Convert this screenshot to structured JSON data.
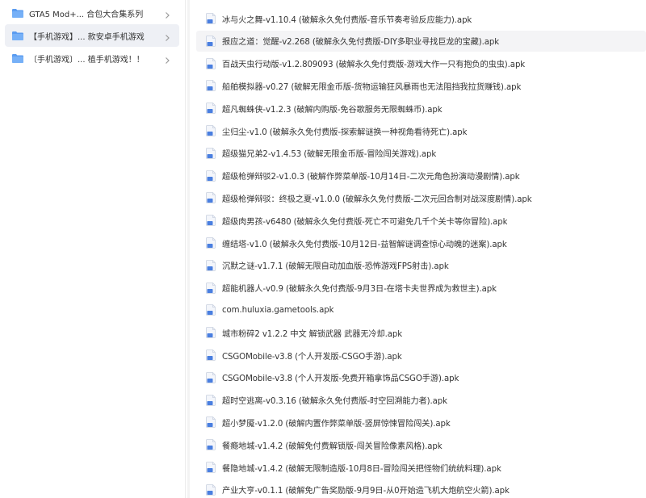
{
  "sidebar": {
    "items": [
      {
        "label": "GTA5 Mod+... 合包大合集系列",
        "icon": "folder-icon",
        "selected": false
      },
      {
        "label": "【手机游戏】... 款安卓手机游戏",
        "icon": "folder-icon",
        "selected": true
      },
      {
        "label": "〔手机游戏〕... 植手机游戏！！",
        "icon": "folder-icon",
        "selected": false
      }
    ]
  },
  "colors": {
    "folder": "#5b9cf0",
    "selected_bg": "#eef0f5",
    "apk_icon": "#4a7fe0"
  },
  "files": [
    "冰与火之舞-v1.10.4 (破解永久免付费版-音乐节奏考验反应能力).apk",
    "报应之道：觉醒-v2.268 (破解永久免付费版-DIY多职业寻找巨龙的宝藏).apk",
    "百战天虫行动版-v1.2.809093 (破解永久免付费版-游戏大作一只有抱负的虫虫).apk",
    "船舶模拟器-v0.27 (破解无限金币版-货物运输狂风暴雨也无法阻挡我拉货赚钱).apk",
    "超凡蜘蛛侠-v1.2.3 (破解内购版-免谷歌服务无限蜘蛛币).apk",
    "尘归尘-v1.0 (破解永久免付费版-探索解谜换一种视角看待死亡).apk",
    "超级猫兄弟2-v1.4.53 (破解无限金币版-冒险闯关游戏).apk",
    "超级枪弹辩驳2-v1.0.3 (破解作弊菜单版-10月14日-二次元角色扮演动漫剧情).apk",
    "超级枪弹辩驳：终极之夏-v1.0.0 (破解永久免付费版-二次元回合制对战深度剧情).apk",
    "超级肉男孩-v6480 (破解永久免付费版-死亡不可避免几千个关卡等你冒险).apk",
    "缠结塔-v1.0 (破解永久免付费版-10月12日-益智解谜调查惊心动魄的迷案).apk",
    "沉默之谜-v1.7.1 (破解无限自动加血版-恐怖游戏FPS射击).apk",
    "超能机器人-v0.9 (破解永久免付费版-9月3日-在塔卡夫世界成为救世主).apk",
    "com.huluxia.gametools.apk",
    "城市粉碎2 v1.2.2 中文 解锁武器 武器无冷却.apk",
    "CSGOMobile-v3.8 (个人开发版-CSGO手游).apk",
    "CSGOMobile-v3.8 (个人开发版-免费开箱拿饰品CSGO手游).apk",
    "超时空逃离-v0.3.16 (破解永久免付费版-时空回溯能力者).apk",
    "超小梦魇-v1.2.0 (破解内置作弊菜单版-竖屏惊悚冒险闯关).apk",
    "餐瘾地城-v1.4.2 (破解免付费解锁版-闯关冒险像素风格).apk",
    "餐隐地城-v1.4.2 (破解无限制造版-10月8日-冒险闯关把怪物们统统料理).apk",
    "产业大亨-v0.1.1 (破解免广告奖励版-9月9日-从0开始造飞机大炮航空火箭).apk"
  ]
}
